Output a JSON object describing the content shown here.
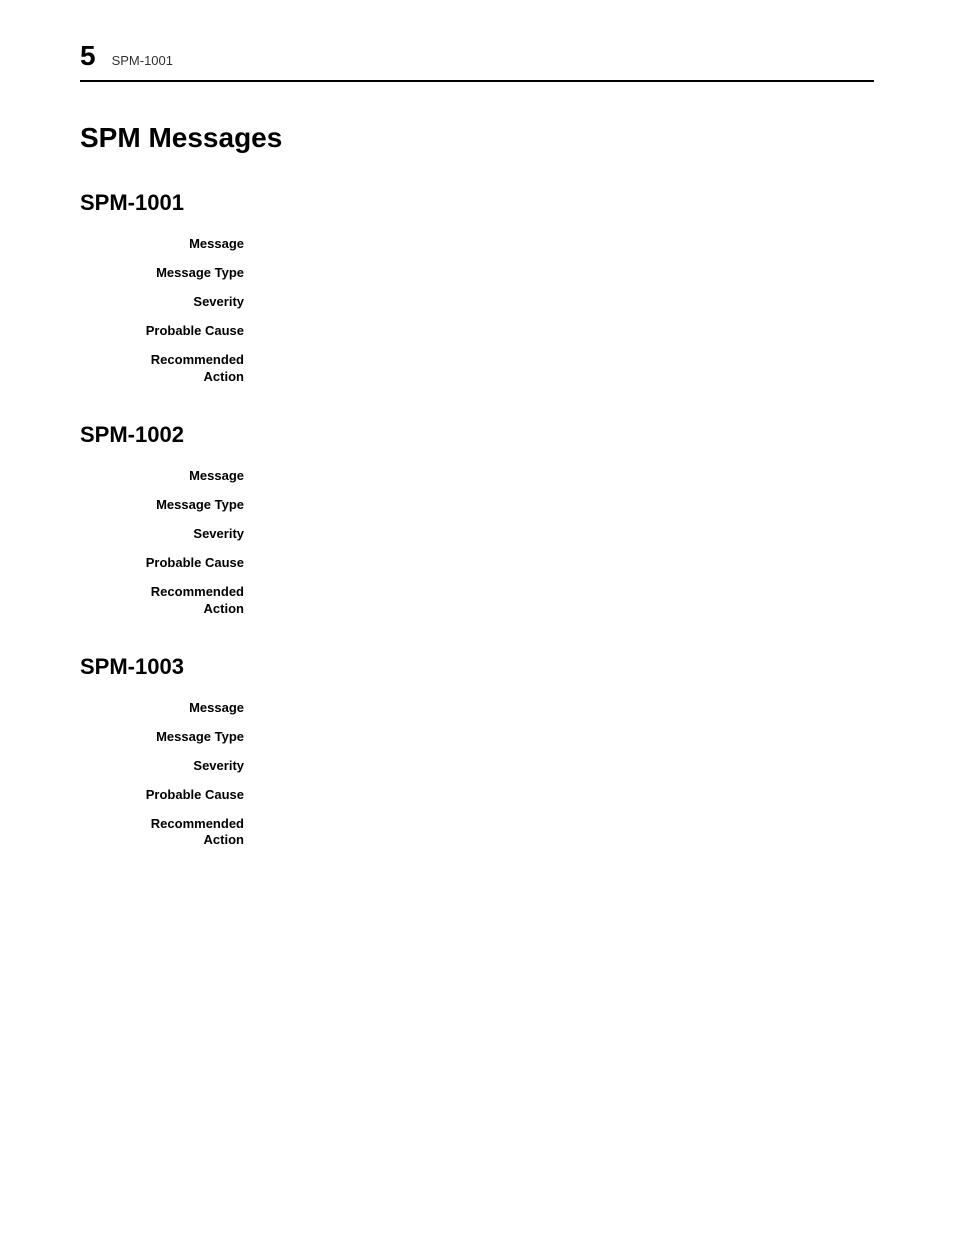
{
  "header": {
    "page_number": "5",
    "subtitle": "SPM-1001"
  },
  "chapter_title": "SPM Messages",
  "sections": [
    {
      "id": "SPM-1001",
      "title": "SPM-1001",
      "fields": [
        {
          "label": "Message",
          "value": ""
        },
        {
          "label": "Message Type",
          "value": ""
        },
        {
          "label": "Severity",
          "value": ""
        },
        {
          "label": "Probable Cause",
          "value": ""
        },
        {
          "label": "Recommended\nAction",
          "value": ""
        }
      ]
    },
    {
      "id": "SPM-1002",
      "title": "SPM-1002",
      "fields": [
        {
          "label": "Message",
          "value": ""
        },
        {
          "label": "Message Type",
          "value": ""
        },
        {
          "label": "Severity",
          "value": ""
        },
        {
          "label": "Probable Cause",
          "value": ""
        },
        {
          "label": "Recommended\nAction",
          "value": ""
        }
      ]
    },
    {
      "id": "SPM-1003",
      "title": "SPM-1003",
      "fields": [
        {
          "label": "Message",
          "value": ""
        },
        {
          "label": "Message Type",
          "value": ""
        },
        {
          "label": "Severity",
          "value": ""
        },
        {
          "label": "Probable Cause",
          "value": ""
        },
        {
          "label": "Recommended\nAction",
          "value": ""
        }
      ]
    }
  ]
}
